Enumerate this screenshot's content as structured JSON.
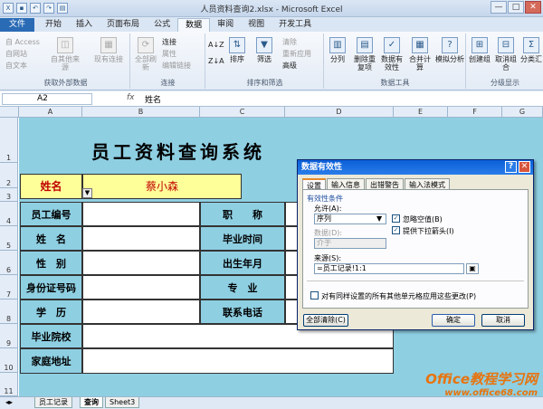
{
  "window": {
    "title": "人员资料查询2.xlsx - Microsoft Excel",
    "buttons": [
      "—",
      "□",
      "✕"
    ]
  },
  "tabs": [
    "文件",
    "开始",
    "插入",
    "页面布局",
    "公式",
    "数据",
    "审阅",
    "视图",
    "开发工具"
  ],
  "ribbon": {
    "ext": {
      "access": "自 Access",
      "web": "自网站",
      "text": "自文本",
      "other": "自其他来源",
      "existing": "现有连接",
      "label": "获取外部数据"
    },
    "conn": {
      "refresh": "全部刷新",
      "connections": "连接",
      "properties": "属性",
      "edit_links": "编辑链接",
      "label": "连接"
    },
    "sort": {
      "sort": "排序",
      "filter": "筛选",
      "clear": "清除",
      "reapply": "重新应用",
      "advanced": "高级",
      "label": "排序和筛选"
    },
    "tools": {
      "split": "分列",
      "dedupe": "删除重复项",
      "validation": "数据有效性",
      "consolidate": "合并计算",
      "whatif": "模拟分析",
      "label": "数据工具"
    },
    "outline": {
      "group": "创建组",
      "ungroup": "取消组合",
      "subtotal": "分类汇",
      "label": "分级显示"
    }
  },
  "formula_bar": {
    "name_box": "A2",
    "fx": "fx",
    "value": "姓名"
  },
  "columns": [
    "A",
    "B",
    "C",
    "D",
    "E",
    "F",
    "G"
  ],
  "rows": [
    "1",
    "2",
    "3",
    "4",
    "5",
    "6",
    "7",
    "8",
    "9",
    "10",
    "11"
  ],
  "form": {
    "title": "员工资料查询系统",
    "name_label": "姓名",
    "name_value": "蔡小森",
    "left_labels": [
      "员工编号",
      "姓　名",
      "性　别",
      "身份证号码",
      "学　历",
      "毕业院校",
      "家庭地址"
    ],
    "right_labels": [
      "职　　称",
      "毕业时间",
      "出生年月",
      "专　业",
      "联系电话"
    ]
  },
  "dialog": {
    "title": "数据有效性",
    "tabs": [
      "设置",
      "输入信息",
      "出错警告",
      "输入法模式"
    ],
    "section": "有效性条件",
    "allow_label": "允许(A):",
    "allow_value": "序列",
    "data_label": "数据(D):",
    "data_value": "介于",
    "ignore_blank": "忽略空值(B)",
    "dropdown": "提供下拉箭头(I)",
    "source_label": "来源(S):",
    "source_value": "=员工记录!1:1",
    "apply_all": "对有同样设置的所有其他单元格应用这些更改(P)",
    "clear_all": "全部清除(C)",
    "ok": "确定",
    "cancel": "取消"
  },
  "sheets": [
    "员工记录",
    "查询",
    "Sheet3"
  ],
  "watermark": {
    "line1": "Office教程学习网",
    "line2": "www.office68.com"
  }
}
